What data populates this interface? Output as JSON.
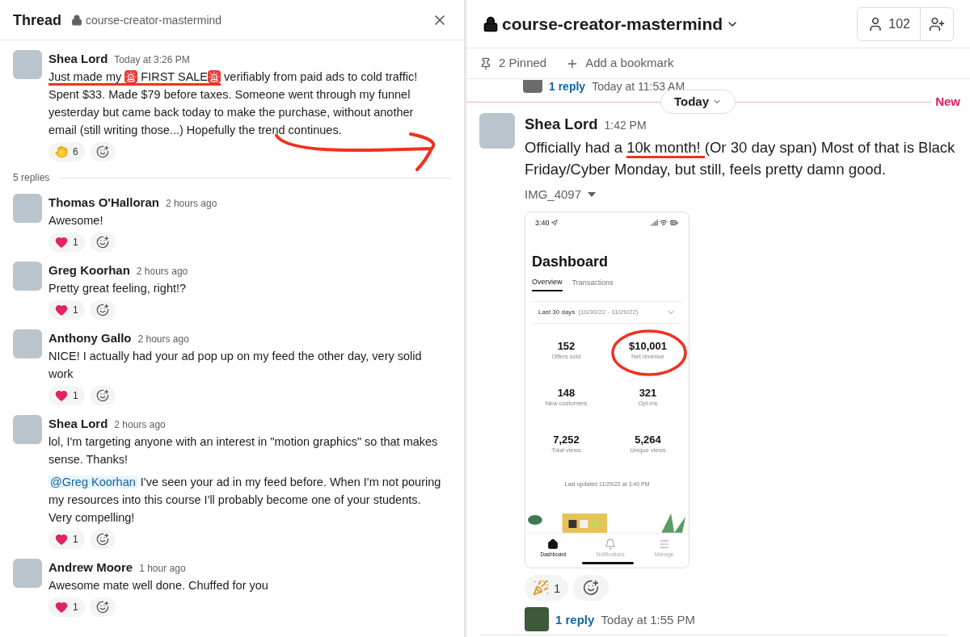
{
  "thread": {
    "title": "Thread",
    "channel": "course-creator-mastermind",
    "parent": {
      "author": "Shea Lord",
      "time": "Today at 3:26 PM",
      "paragraphs": [
        [
          {
            "kind": "text",
            "text": "Just made my ",
            "marked": true
          },
          {
            "kind": "siren",
            "marked": true
          },
          {
            "kind": "text",
            "text": " FIRST SALE",
            "marked": true
          },
          {
            "kind": "siren",
            "marked": true
          },
          {
            "kind": "text",
            "text": "  verifiably from paid ads to cold traffic! Spent $33. Made $79 before taxes. Someone went through my funnel yesterday but came back today to make the purchase, without another email (still writing those...) Hopefully the trend continues.",
            "marked": false
          }
        ]
      ],
      "reactions": [
        {
          "kind": "hands",
          "count": "6"
        }
      ]
    },
    "reply_count": "5 replies",
    "replies": [
      {
        "author": "Thomas O'Halloran",
        "time": "2 hours ago",
        "paragraphs": [
          [
            {
              "kind": "text",
              "text": "Awesome!",
              "marked": false
            }
          ]
        ],
        "reactions": [
          {
            "kind": "heart",
            "count": "1"
          }
        ]
      },
      {
        "author": "Greg Koorhan",
        "time": "2 hours ago",
        "paragraphs": [
          [
            {
              "kind": "text",
              "text": "Pretty great feeling, right!?",
              "marked": false
            }
          ]
        ],
        "reactions": [
          {
            "kind": "heart",
            "count": "1"
          }
        ]
      },
      {
        "author": "Anthony Gallo",
        "time": "2 hours ago",
        "paragraphs": [
          [
            {
              "kind": "text",
              "text": "NICE! I actually had your ad pop up on my feed the other day, very solid work",
              "marked": false
            }
          ]
        ],
        "reactions": [
          {
            "kind": "heart",
            "count": "1"
          }
        ]
      },
      {
        "author": "Shea Lord",
        "time": "2 hours ago",
        "paragraphs": [
          [
            {
              "kind": "text",
              "text": "lol, I'm targeting anyone with an interest in \"motion graphics\" so that makes sense. Thanks!",
              "marked": false
            }
          ],
          [
            {
              "kind": "mention",
              "text": "@Greg Koorhan"
            },
            {
              "kind": "text",
              "text": " I've seen your ad in my feed before. When I'm not pouring my resources into this course I'll probably become one of your students. Very compelling!",
              "marked": false
            }
          ]
        ],
        "reactions": [
          {
            "kind": "heart",
            "count": "1"
          }
        ]
      },
      {
        "author": "Andrew Moore",
        "time": "1 hour ago",
        "paragraphs": [
          [
            {
              "kind": "text",
              "text": "Awesome mate well done.  Chuffed for you",
              "marked": false
            }
          ]
        ],
        "reactions": [
          {
            "kind": "heart",
            "count": "1"
          }
        ]
      }
    ]
  },
  "channel": {
    "name": "course-creator-mastermind",
    "members": "102",
    "pinned": "2 Pinned",
    "bookmark": "Add a bookmark",
    "earlier_thread": {
      "replies": "1 reply",
      "time": "Today at 11:53 AM"
    },
    "divider": {
      "label": "Today",
      "new_label": "New"
    },
    "message": {
      "author": "Shea Lord",
      "time": "1:42 PM",
      "paragraphs": [
        [
          {
            "kind": "text",
            "text": "Officially had a ",
            "marked": false
          },
          {
            "kind": "text",
            "text": "10k month! ",
            "marked": true
          },
          {
            "kind": "text",
            "text": "(Or 30 day span) Most of that is Black Friday/Cyber Monday, but still, feels pretty damn good.",
            "marked": false
          }
        ]
      ],
      "attachment": "IMG_4097",
      "phone": {
        "clock": "3:40",
        "title": "Dashboard",
        "tabs": [
          {
            "label": "Overview",
            "selected": true
          },
          {
            "label": "Transactions",
            "selected": false
          }
        ],
        "range": "Last 30 days",
        "range_dates": "(10/30/22 - 11/29/22)",
        "stats": [
          {
            "value": "152",
            "label": "Offers sold",
            "circled": false
          },
          {
            "value": "$10,001",
            "label": "Net revenue",
            "circled": true
          },
          {
            "value": "148",
            "label": "New customers",
            "circled": false
          },
          {
            "value": "321",
            "label": "Opt-ins",
            "circled": false
          },
          {
            "value": "7,252",
            "label": "Total views",
            "circled": false
          },
          {
            "value": "5,264",
            "label": "Unique views",
            "circled": false
          }
        ],
        "updated": "Last updated 11/29/22 at 3:40 PM",
        "nav": [
          {
            "kind": "home",
            "label": "Dashboard",
            "selected": true
          },
          {
            "kind": "bell",
            "label": "Notifications",
            "selected": false
          },
          {
            "kind": "menu",
            "label": "Manage",
            "selected": false
          }
        ]
      },
      "reactions": [
        {
          "kind": "party",
          "count": "1"
        }
      ],
      "thread": {
        "replies": "1 reply",
        "time": "Today at 1:55 PM"
      }
    }
  }
}
